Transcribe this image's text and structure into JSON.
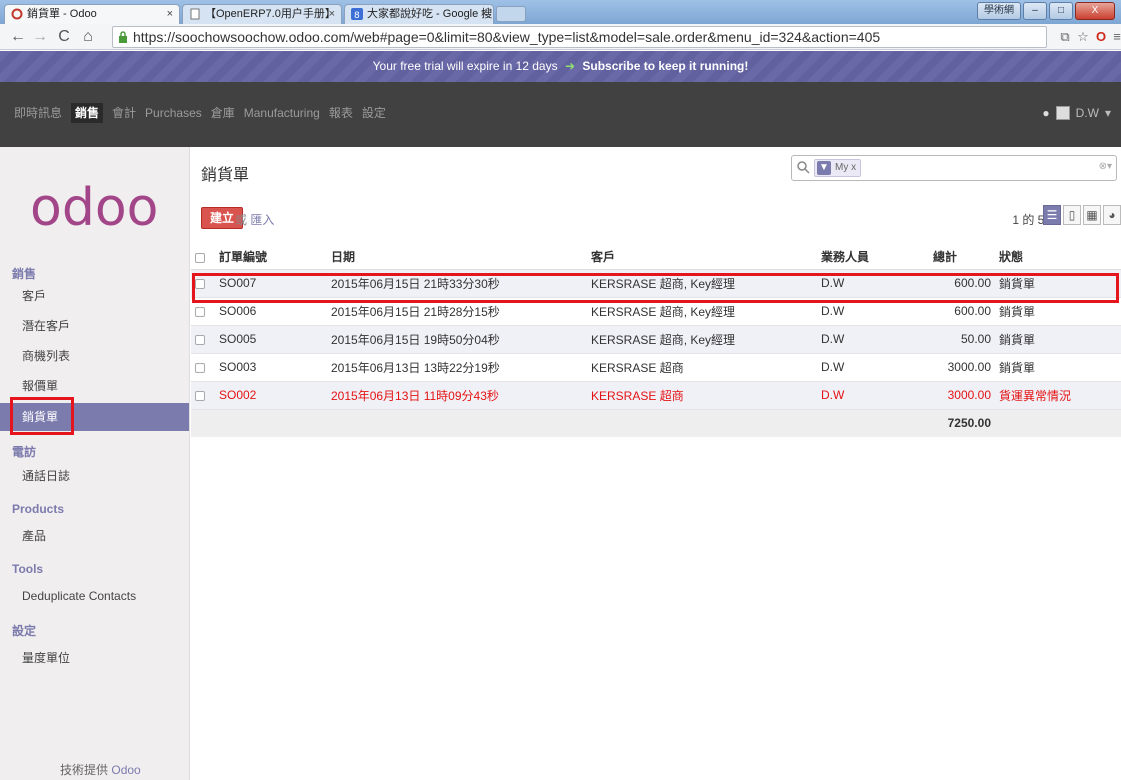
{
  "browser": {
    "tabs": [
      {
        "title": "銷貨單 - Odoo",
        "active": true
      },
      {
        "title": "【OpenERP7.0用户手册】",
        "active": false
      },
      {
        "title": "大家都說好吃 - Google 搜",
        "active": false
      }
    ],
    "close_glyph": "×",
    "url": "https://soochowsoochow.odoo.com/web#page=0&limit=80&view_type=list&model=sale.order&menu_id=324&action=405",
    "window_label": "學術網"
  },
  "banner": {
    "text": "Your free trial will expire in 12 days",
    "link": "Subscribe to keep it running!"
  },
  "topnav": {
    "items": [
      "即時訊息",
      "銷售",
      "會計",
      "Purchases",
      "倉庫",
      "Manufacturing",
      "報表",
      "設定"
    ],
    "active": "銷售",
    "user": "D.W"
  },
  "sidebar": {
    "logo_text": "odoo",
    "sections": [
      {
        "title": "銷售",
        "items": [
          "客戶",
          "潛在客戶",
          "商機列表",
          "報價單",
          "銷貨單"
        ]
      },
      {
        "title": "電訪",
        "items": [
          "通話日誌"
        ]
      },
      {
        "title": "Products",
        "items": [
          "產品"
        ]
      },
      {
        "title": "Tools",
        "items": [
          "Deduplicate Contacts"
        ]
      },
      {
        "title": "設定",
        "items": [
          "量度單位"
        ]
      }
    ],
    "active_item": "銷貨單",
    "powered_by": "技術提供",
    "powered_by_brand": "Odoo"
  },
  "main": {
    "title": "銷貨單",
    "search_facet": "My x",
    "create_label": "建立",
    "or_label": "或",
    "import_label": "匯入",
    "pager": "1 的 5-5",
    "columns": [
      "訂單編號",
      "日期",
      "客戶",
      "業務人員",
      "總計",
      "狀態"
    ],
    "rows": [
      {
        "id": "SO007",
        "date": "2015年06月15日 21時33分30秒",
        "customer": "KERSRASE 超商, Key經理",
        "salesperson": "D.W",
        "total": "600.00",
        "status": "銷貨單",
        "alert": false
      },
      {
        "id": "SO006",
        "date": "2015年06月15日 21時28分15秒",
        "customer": "KERSRASE 超商, Key經理",
        "salesperson": "D.W",
        "total": "600.00",
        "status": "銷貨單",
        "alert": false
      },
      {
        "id": "SO005",
        "date": "2015年06月15日 19時50分04秒",
        "customer": "KERSRASE 超商, Key經理",
        "salesperson": "D.W",
        "total": "50.00",
        "status": "銷貨單",
        "alert": false
      },
      {
        "id": "SO003",
        "date": "2015年06月13日 13時22分19秒",
        "customer": "KERSRASE 超商",
        "salesperson": "D.W",
        "total": "3000.00",
        "status": "銷貨單",
        "alert": false
      },
      {
        "id": "SO002",
        "date": "2015年06月13日 11時09分43秒",
        "customer": "KERSRASE 超商",
        "salesperson": "D.W",
        "total": "3000.00",
        "status": "貨運異常情況",
        "alert": true
      }
    ],
    "grand_total": "7250.00"
  },
  "colors": {
    "accent": "#7c7bad",
    "nav": "#414141",
    "create": "#d9534f",
    "alert": "#e41313",
    "highlight": "#e4151c"
  }
}
